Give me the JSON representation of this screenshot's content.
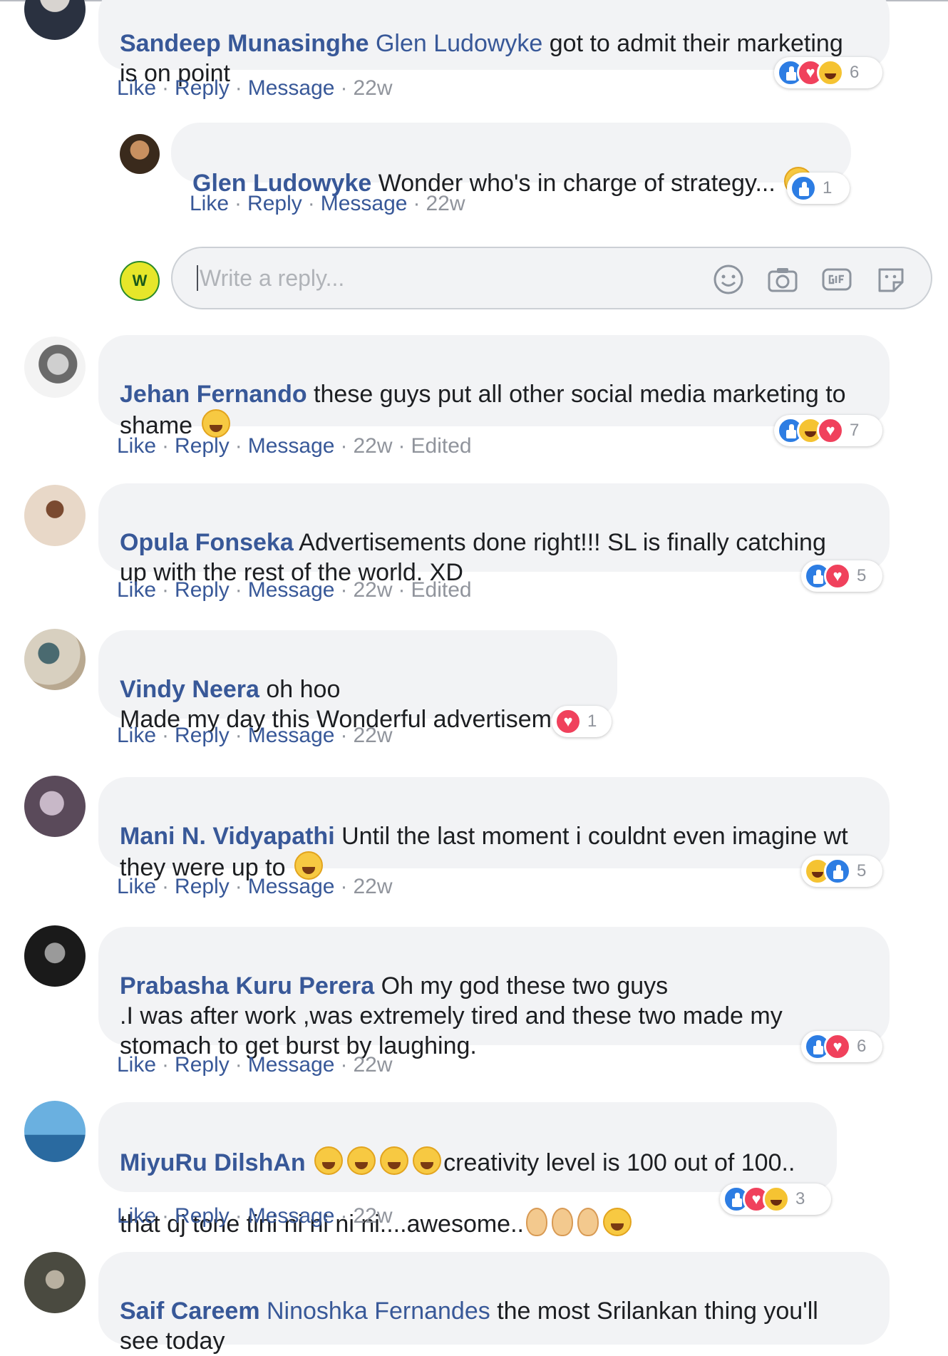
{
  "actions": {
    "like": "Like",
    "reply": "Reply",
    "message": "Message",
    "edited": "Edited",
    "sep": "·"
  },
  "reply_box": {
    "placeholder": "Write a reply...",
    "avatar_text": "W"
  },
  "comments": [
    {
      "author": "Sandeep Munasinghe",
      "mention": "Glen Ludowyke",
      "text": " got to admit their marketing\nis on point",
      "time": "22w",
      "reactions": [
        "like",
        "love",
        "haha"
      ],
      "reaction_count": "6"
    },
    {
      "author": "Glen Ludowyke",
      "text": " Wonder who's in charge of strategy...",
      "time": "22w",
      "reactions": [
        "like"
      ],
      "reaction_count": "1"
    },
    {
      "author": "Jehan Fernando",
      "text": " these guys put all other social media marketing to\nshame",
      "time": "22w",
      "reactions": [
        "like",
        "haha",
        "love"
      ],
      "reaction_count": "7"
    },
    {
      "author": "Opula Fonseka",
      "text": " Advertisements done right!!! SL is finally catching\nup with the rest of the world. XD",
      "time": "22w",
      "reactions": [
        "like",
        "love"
      ],
      "reaction_count": "5"
    },
    {
      "author": "Vindy Neera",
      "text": " oh hoo\nMade my day this Wonderful advertisement",
      "time": "22w",
      "reactions": [
        "love"
      ],
      "reaction_count": "1"
    },
    {
      "author": "Mani N. Vidyapathi",
      "text": " Until the last moment i couldnt even imagine wt\nthey were up to",
      "time": "22w",
      "reactions": [
        "haha",
        "like"
      ],
      "reaction_count": "5"
    },
    {
      "author": "Prabasha Kuru Perera",
      "text": " Oh my god these two guys\n.I was after work ,was extremely tired and these two made my\nstomach to get burst by laughing.",
      "time": "22w",
      "reactions": [
        "like",
        "love"
      ],
      "reaction_count": "6"
    },
    {
      "author": "MiyuRu DilshAn",
      "text_a": "creativity level is 100 out of 100..",
      "text_b": "that dj tone tini ni ni ni ni....awesome..",
      "time": "22w",
      "reactions": [
        "like",
        "love",
        "haha"
      ],
      "reaction_count": "3"
    },
    {
      "author": "Saif Careem",
      "mention": "Ninoshka Fernandes",
      "text": " the most Srilankan thing you'll\nsee today"
    }
  ],
  "icons": [
    "emoji-icon",
    "camera-icon",
    "gif-icon",
    "sticker-icon"
  ],
  "colors": {
    "link": "#385898",
    "meta": "#90949c",
    "bubble": "#f2f3f5",
    "like": "#2d7de3",
    "love": "#f0415c",
    "haha": "#f5c332"
  }
}
